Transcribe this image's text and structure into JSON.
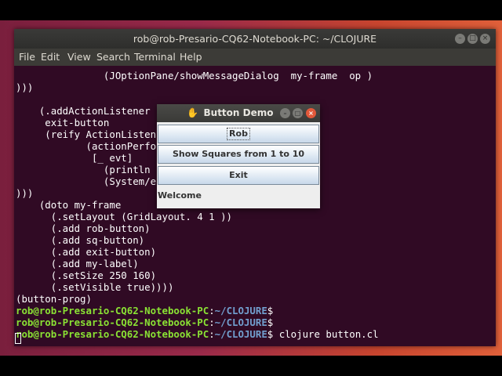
{
  "terminal": {
    "title": "rob@rob-Presario-CQ62-Notebook-PC: ~/CLOJURE",
    "menu": [
      "File",
      "Edit",
      "View",
      "Search",
      "Terminal",
      "Help"
    ],
    "lines": [
      "               (JOptionPane/showMessageDialog  my-frame  op )",
      ")))",
      "",
      "    (.addActionListener",
      "     exit-button",
      "     (reify ActionListen",
      "            (actionPerfo",
      "             [_ evt]",
      "               (println",
      "               (System/e",
      ")))",
      "    (doto my-frame",
      "      (.setLayout (GridLayout. 4 1 ))",
      "      (.add rob-button)",
      "      (.add sq-button)",
      "      (.add exit-button)",
      "      (.add my-label)",
      "      (.setSize 250 160)",
      "      (.setVisible true))))",
      "(button-prog)"
    ],
    "prompt_user": "rob@rob-Presario-CQ62-Notebook-PC",
    "prompt_path": "~/CLOJURE",
    "prompt_sym": "$",
    "last_command": " clojure button.cl"
  },
  "dialog": {
    "title": "Button Demo",
    "buttons": {
      "rob": "Rob",
      "squares": "Show Squares from 1 to 10",
      "exit": "Exit"
    },
    "label": "Welcome"
  },
  "colors": {
    "terminal_bg": "#300a24",
    "prompt_user": "#8ae234",
    "prompt_path": "#729fcf"
  }
}
